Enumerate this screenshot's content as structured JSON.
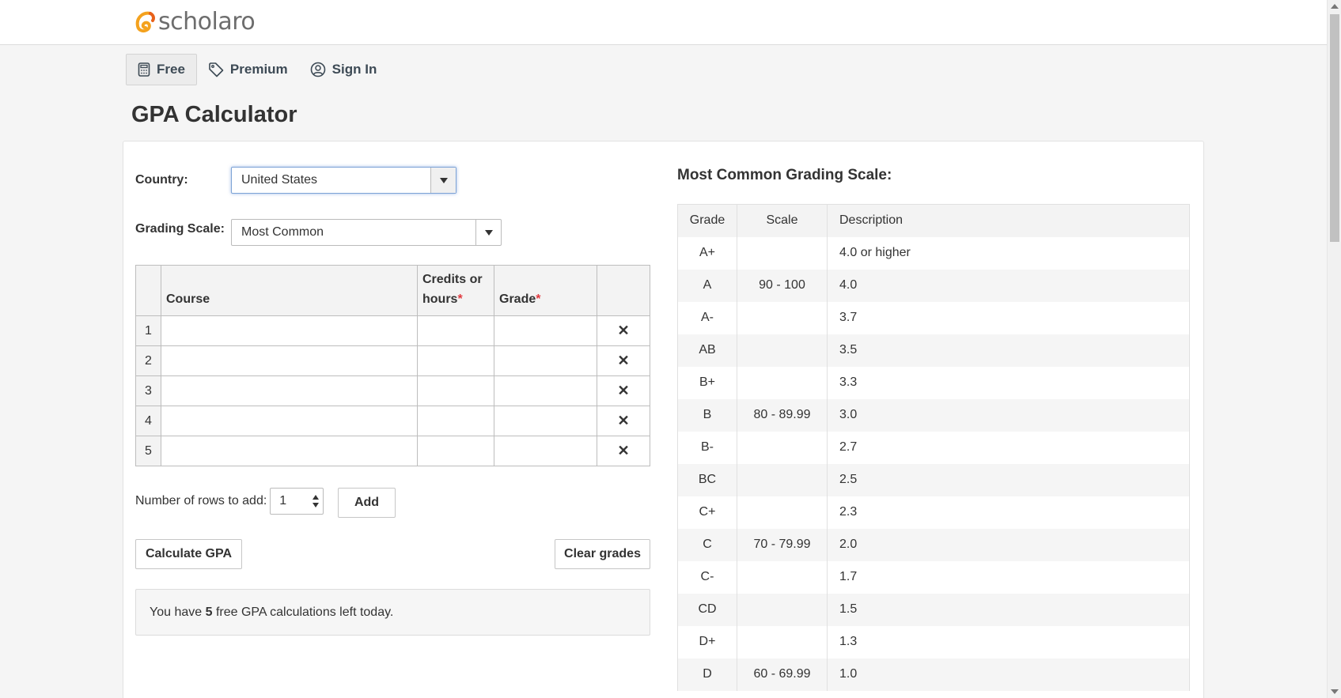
{
  "brand": {
    "name": "scholaro",
    "logo_icon": "swirl-logo-icon",
    "accent": "#f4a21e"
  },
  "nav": [
    {
      "label": "Free",
      "icon": "calculator-icon",
      "active": true
    },
    {
      "label": "Premium",
      "icon": "tag-icon",
      "active": false
    },
    {
      "label": "Sign In",
      "icon": "user-circle-icon",
      "active": false
    }
  ],
  "page_title": "GPA Calculator",
  "form": {
    "country_label": "Country:",
    "country_value": "United States",
    "scale_label": "Grading Scale:",
    "scale_value": "Most Common"
  },
  "courses_table": {
    "headers": {
      "course": "Course",
      "credits": "Credits or hours",
      "grade": "Grade",
      "required_mark": "*"
    },
    "rows": [
      "1",
      "2",
      "3",
      "4",
      "5"
    ],
    "delete_glyph": "✕"
  },
  "rows_add": {
    "label": "Number of rows to add:",
    "value": "1",
    "add_label": "Add"
  },
  "buttons": {
    "calculate": "Calculate GPA",
    "clear": "Clear grades"
  },
  "notice": {
    "prefix": "You have ",
    "count": "5",
    "suffix": " free GPA calculations left today."
  },
  "grading_scale": {
    "title": "Most Common Grading Scale:",
    "headers": [
      "Grade",
      "Scale",
      "Description"
    ],
    "rows": [
      {
        "grade": "A+",
        "scale": "",
        "desc": "4.0 or higher"
      },
      {
        "grade": "A",
        "scale": "90 - 100",
        "desc": "4.0"
      },
      {
        "grade": "A-",
        "scale": "",
        "desc": "3.7"
      },
      {
        "grade": "AB",
        "scale": "",
        "desc": "3.5"
      },
      {
        "grade": "B+",
        "scale": "",
        "desc": "3.3"
      },
      {
        "grade": "B",
        "scale": "80 - 89.99",
        "desc": "3.0"
      },
      {
        "grade": "B-",
        "scale": "",
        "desc": "2.7"
      },
      {
        "grade": "BC",
        "scale": "",
        "desc": "2.5"
      },
      {
        "grade": "C+",
        "scale": "",
        "desc": "2.3"
      },
      {
        "grade": "C",
        "scale": "70 - 79.99",
        "desc": "2.0"
      },
      {
        "grade": "C-",
        "scale": "",
        "desc": "1.7"
      },
      {
        "grade": "CD",
        "scale": "",
        "desc": "1.5"
      },
      {
        "grade": "D+",
        "scale": "",
        "desc": "1.3"
      },
      {
        "grade": "D",
        "scale": "60 - 69.99",
        "desc": "1.0"
      }
    ]
  }
}
